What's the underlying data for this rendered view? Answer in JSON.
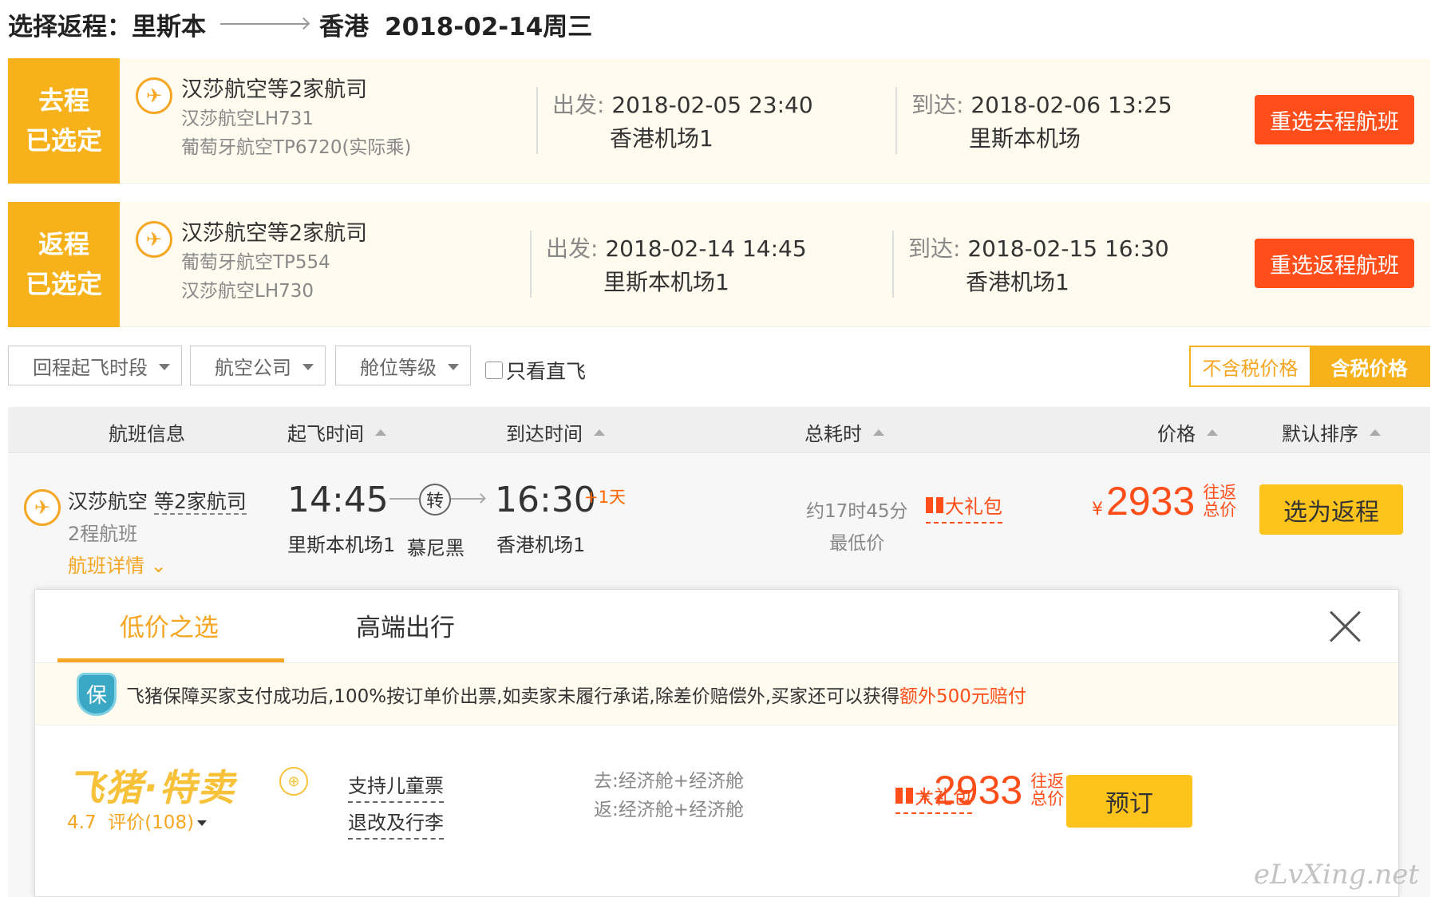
{
  "header": {
    "label": "选择返程：",
    "from": "里斯本",
    "to": "香港",
    "date": "2018-02-14周三"
  },
  "selected_flights": [
    {
      "tag_line1": "去程",
      "tag_line2": "已选定",
      "airline_group": "汉莎航空等2家航司",
      "flight1": "汉莎航空LH731",
      "flight2": "葡萄牙航空TP6720(实际乘)",
      "dep_label": "出发:",
      "dep_time": "2018-02-05 23:40",
      "dep_airport": "香港机场1",
      "arr_label": "到达:",
      "arr_time": "2018-02-06 13:25",
      "arr_airport": "里斯本机场",
      "reselect": "重选去程航班"
    },
    {
      "tag_line1": "返程",
      "tag_line2": "已选定",
      "airline_group": "汉莎航空等2家航司",
      "flight1": "葡萄牙航空TP554",
      "flight2": "汉莎航空LH730",
      "dep_label": "出发:",
      "dep_time": "2018-02-14 14:45",
      "dep_airport": "里斯本机场1",
      "arr_label": "到达:",
      "arr_time": "2018-02-15 16:30",
      "arr_airport": "香港机场1",
      "reselect": "重选返程航班"
    }
  ],
  "filters": {
    "time_slot": "回程起飞时段",
    "airline": "航空公司",
    "cabin": "舱位等级",
    "direct_only": "只看直飞",
    "price_excl_tax": "不含税价格",
    "price_incl_tax": "含税价格"
  },
  "columns": {
    "info": "航班信息",
    "dep_time": "起飞时间",
    "arr_time": "到达时间",
    "duration": "总耗时",
    "price": "价格",
    "sort": "默认排序"
  },
  "result": {
    "airline": "汉莎航空",
    "airline_more": "等2家航司",
    "legs": "2程航班",
    "detail": "航班详情",
    "dep_time": "14:45",
    "dep_airport": "里斯本机场1",
    "transfer_icon": "转",
    "transfer_city": "慕尼黑",
    "arr_time": "16:30",
    "arr_plus": "+1天",
    "arr_airport": "香港机场1",
    "duration": "约17时45分",
    "lowest": "最低价",
    "gift": "大礼包",
    "currency": "¥",
    "price": "2933",
    "price_label1": "往返",
    "price_label2": "总价",
    "select": "选为返程"
  },
  "panel": {
    "tab_low": "低价之选",
    "tab_high": "高端出行",
    "guarantee_icon": "保",
    "guarantee_text": "飞猪保障买家支付成功后,100%按订单价出票,如卖家未履行承诺,除差价赔偿外,买家还可以获得",
    "guarantee_highlight": "额外500元赔付",
    "seller_logo": "飞猪·特卖",
    "seller_seal": "⊕",
    "rating": "4.7",
    "rating_count": "评价(108)",
    "child_ticket": "支持儿童票",
    "refund": "退改及行李",
    "cabin_out": "去:经济舱+经济舱",
    "cabin_back": "返:经济舱+经济舱",
    "gift": "大礼包",
    "currency": "¥",
    "price": "2933",
    "price_label1": "往返",
    "price_label2": "总价",
    "book": "预订"
  },
  "watermark": "eLvXing.net",
  "colors": {
    "accent_orange": "#f7b21b",
    "price_red": "#ff4e1a",
    "button_yellow": "#ffc41b"
  }
}
